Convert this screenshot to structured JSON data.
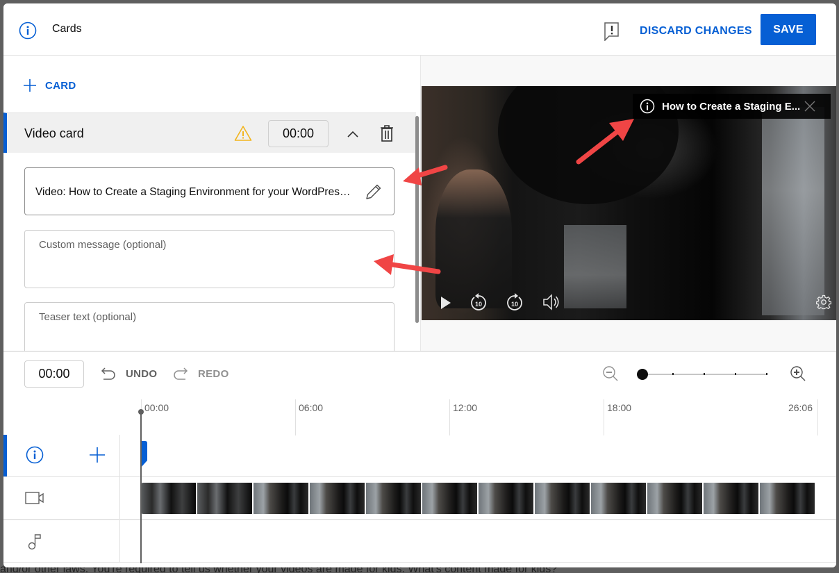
{
  "backdrop": {
    "text": "and/or other laws. You're required to tell us whether your videos are made for kids. What's content made for kids?"
  },
  "header": {
    "title": "Cards",
    "icon": "info-icon",
    "feedback_icon": "feedback-icon",
    "discard_label": "DISCARD CHANGES",
    "save_label": "SAVE"
  },
  "editor": {
    "add_card_label": "CARD",
    "card": {
      "type_label": "Video card",
      "warning_icon": "warning-icon",
      "start_time": "00:00",
      "video_field_value": "Video: How to Create a Staging Environment for your WordPress Site",
      "custom_message_placeholder": "Custom message (optional)",
      "teaser_text_placeholder": "Teaser text (optional)"
    }
  },
  "preview": {
    "teaser_title": "How to Create a Staging E...",
    "controls": [
      "play-icon",
      "rewind-10-icon",
      "forward-10-icon",
      "volume-icon",
      "settings-icon"
    ],
    "rewind_label": "10",
    "forward_label": "10"
  },
  "timeline": {
    "current_time": "00:00",
    "undo_label": "UNDO",
    "redo_label": "REDO",
    "zoom_level_fraction": 0,
    "ruler_labels": [
      "00:00",
      "06:00",
      "12:00",
      "18:00",
      "26:06"
    ],
    "tracks": [
      {
        "name": "cards",
        "icon": "info-icon",
        "action": "add-icon"
      },
      {
        "name": "video",
        "icon": "video-camera-icon"
      },
      {
        "name": "audio",
        "icon": "music-note-icon"
      }
    ],
    "frame_count": 12
  },
  "colors": {
    "accent": "#065fd4",
    "warning": "#f2b51d",
    "annotation_arrow": "#f04545"
  }
}
